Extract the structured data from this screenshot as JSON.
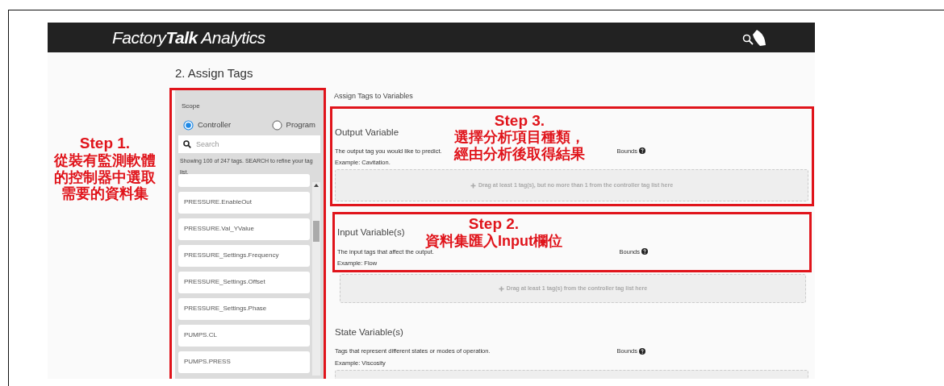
{
  "header": {
    "brand": "Factory**Talk** Analytics"
  },
  "page_title": "2. Assign Tags",
  "tag_panel": {
    "highlighted": true,
    "annotation": {
      "title": "Step 1.",
      "lines": [
        "從裝有監測軟體",
        "的控制器中選取",
        "需要的資料集"
      ]
    },
    "scope_label": "Scope",
    "scope_options": [
      {
        "label": "Controller",
        "selected": true
      },
      {
        "label": "Program",
        "selected": false
      }
    ],
    "search": {
      "placeholder": "Search"
    },
    "info": "Showing 100 of 247 tags. SEARCH to refine your tag list.",
    "tags": [
      "PRESSURE.EnableOut",
      "PRESSURE.Val_YValue",
      "PRESSURE_Settings.Frequency",
      "PRESSURE_Settings.Offset",
      "PRESSURE_Settings.Phase",
      "PUMPS.CL",
      "PUMPS.PRESS"
    ]
  },
  "variables_heading": "Assign Tags to Variables",
  "variables": [
    {
      "title": "Output Variable",
      "highlighted": true,
      "drop_zone_highlighted": true,
      "description": "The output tag you would like to predict.",
      "example": "Example: Cavitation.",
      "bounds": "Bounds",
      "drop_hint": "Drag at least 1 tag(s), but no more than 1 from the controller tag list here",
      "annotation": {
        "title": "Step 3.",
        "lines": [
          "選擇分析項目種類，",
          "經由分析後取得結果"
        ]
      }
    },
    {
      "title": "Input Variable(s)",
      "highlighted": true,
      "drop_zone_highlighted": false,
      "description": "The input tags that affect the output.",
      "example": "Example: Flow",
      "bounds": "Bounds",
      "drop_hint": "Drag at least 1 tag(s) from the controller tag list here",
      "annotation": {
        "title": "Step 2.",
        "lines": [
          "資料集匯入Input欄位"
        ]
      }
    },
    {
      "title": "State Variable(s)",
      "highlighted": false,
      "drop_zone_highlighted": false,
      "description": "Tags that represent different states or modes of operation.",
      "example": "Example: Viscosity",
      "bounds": "Bounds"
    }
  ]
}
